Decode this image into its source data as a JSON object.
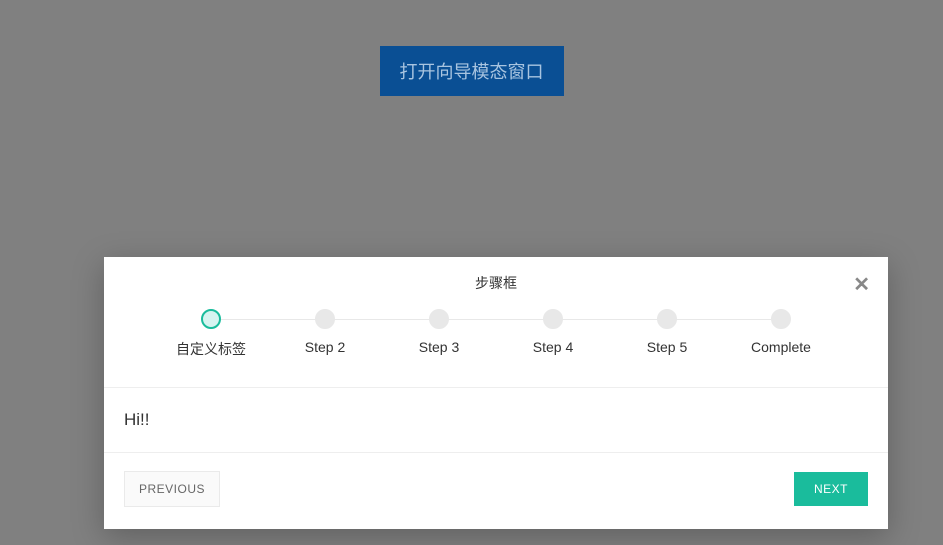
{
  "open_button_label": "打开向导模态窗口",
  "modal": {
    "title": "步骤框",
    "body_text": "Hi!!",
    "prev_label": "PREVIOUS",
    "next_label": "NEXT"
  },
  "steps": [
    {
      "label": "自定义标签",
      "active": true
    },
    {
      "label": "Step 2",
      "active": false
    },
    {
      "label": "Step 3",
      "active": false
    },
    {
      "label": "Step 4",
      "active": false
    },
    {
      "label": "Step 5",
      "active": false
    },
    {
      "label": "Complete",
      "active": false
    }
  ]
}
